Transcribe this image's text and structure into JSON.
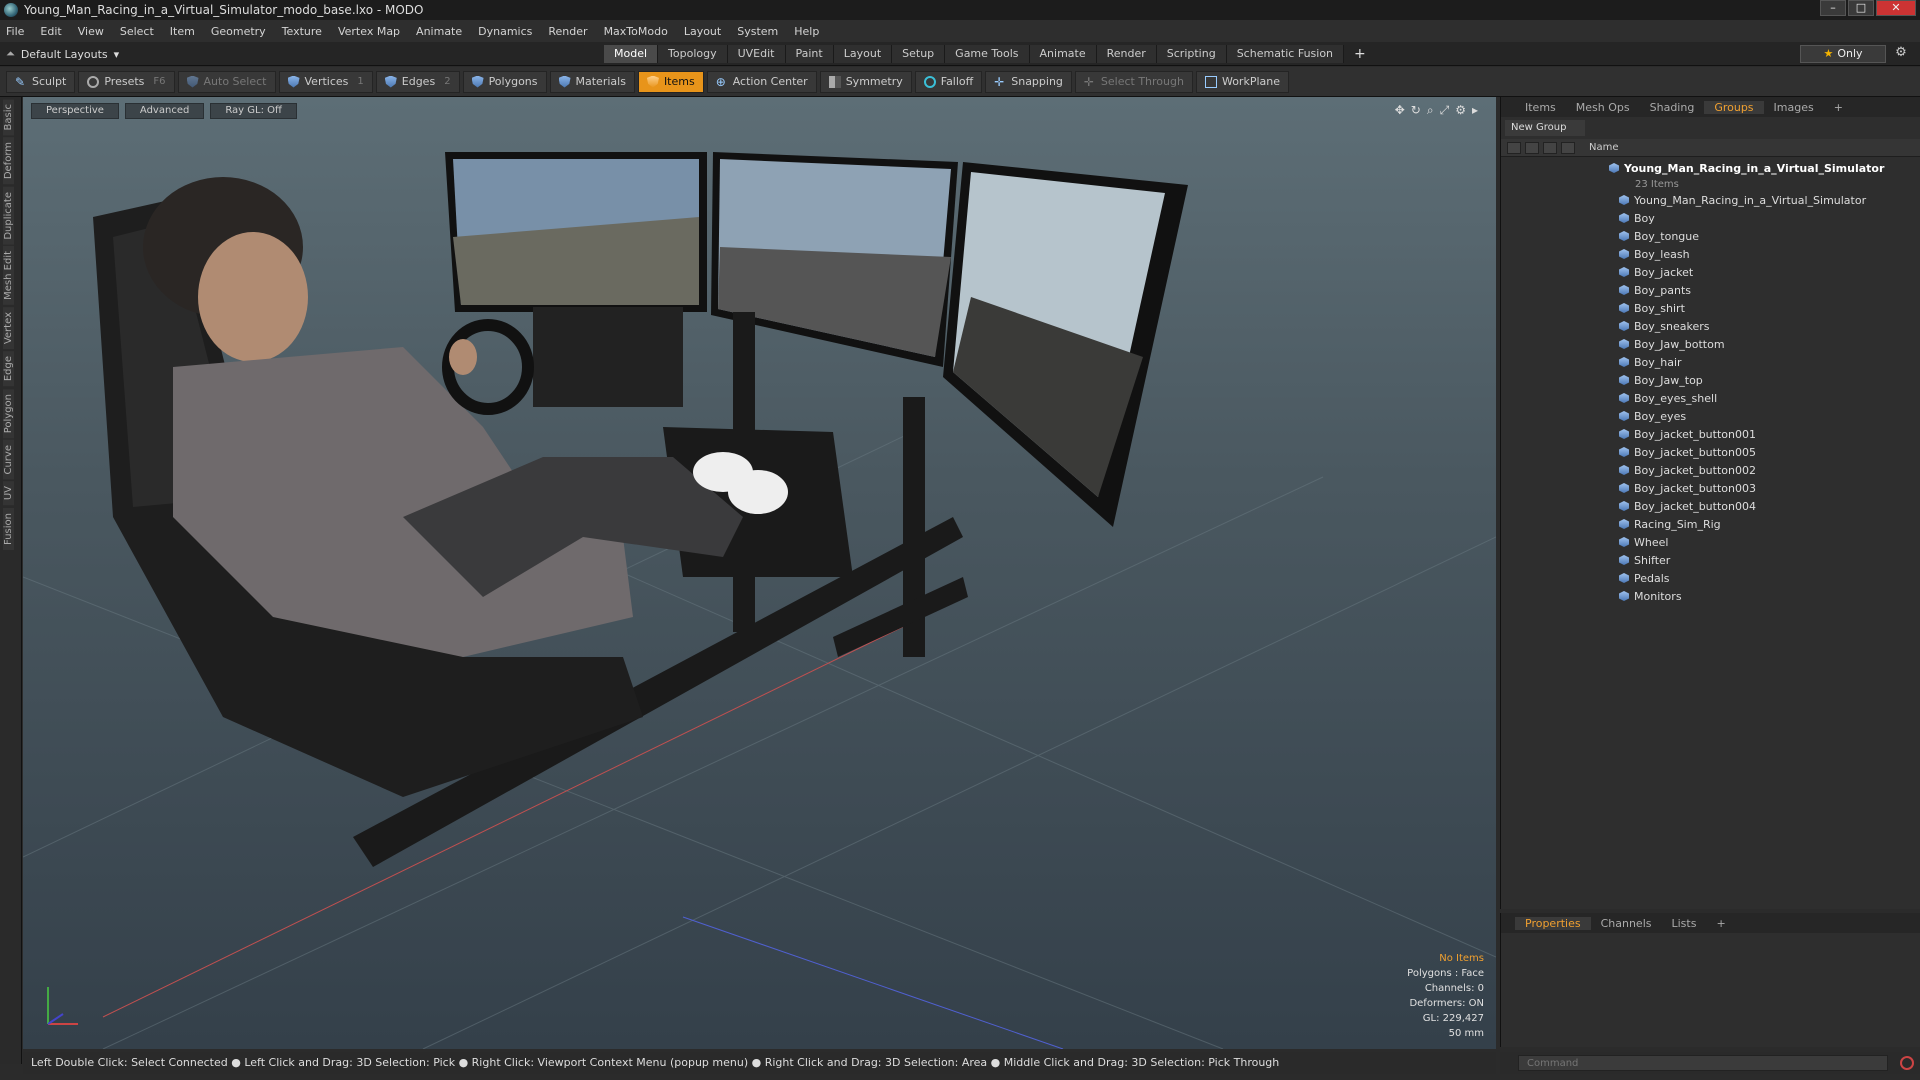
{
  "window": {
    "title": "Young_Man_Racing_in_a_Virtual_Simulator_modo_base.lxo - MODO"
  },
  "menu": [
    "File",
    "Edit",
    "View",
    "Select",
    "Item",
    "Geometry",
    "Texture",
    "Vertex Map",
    "Animate",
    "Dynamics",
    "Render",
    "MaxToModo",
    "Layout",
    "System",
    "Help"
  ],
  "layout": {
    "label": "Default Layouts"
  },
  "mode_tabs": [
    {
      "label": "Model",
      "active": true
    },
    {
      "label": "Topology"
    },
    {
      "label": "UVEdit"
    },
    {
      "label": "Paint"
    },
    {
      "label": "Layout"
    },
    {
      "label": "Setup"
    },
    {
      "label": "Game Tools"
    },
    {
      "label": "Animate"
    },
    {
      "label": "Render"
    },
    {
      "label": "Scripting"
    },
    {
      "label": "Schematic Fusion"
    }
  ],
  "only_label": "Only",
  "toolbar": {
    "sculpt": "Sculpt",
    "presets": "Presets",
    "presets_key": "F6",
    "auto_select": "Auto Select",
    "vertices": "Vertices",
    "vertices_n": "1",
    "edges": "Edges",
    "edges_n": "2",
    "polygons": "Polygons",
    "materials": "Materials",
    "items": "Items",
    "action_center": "Action Center",
    "symmetry": "Symmetry",
    "falloff": "Falloff",
    "snapping": "Snapping",
    "select_through": "Select Through",
    "workplane": "WorkPlane"
  },
  "left_strip": [
    "Basic",
    "Deform",
    "Duplicate",
    "Mesh Edit",
    "Vertex",
    "Edge",
    "Polygon",
    "Curve",
    "UV",
    "Fusion"
  ],
  "viewport": {
    "view": "Perspective",
    "shading": "Advanced",
    "raygl": "Ray GL: Off",
    "info": {
      "items": "No Items",
      "polygons": "Polygons : Face",
      "channels": "Channels: 0",
      "deformers": "Deformers: ON",
      "gl": "GL: 229,427",
      "focal": "50 mm"
    }
  },
  "status": "Left Double Click: Select Connected ● Left Click and Drag: 3D Selection: Pick ● Right Click: Viewport Context Menu (popup menu) ● Right Click and Drag: 3D Selection: Area ● Middle Click and Drag: 3D Selection: Pick Through",
  "panel": {
    "tabs": [
      {
        "label": "Items"
      },
      {
        "label": "Mesh Ops"
      },
      {
        "label": "Shading"
      },
      {
        "label": "Groups",
        "active": true
      },
      {
        "label": "Images"
      }
    ],
    "new_group": "New Group",
    "name_col": "Name",
    "group_name": "Young_Man_Racing_in_a_Virtual_Simulator",
    "group_count": "23 Items",
    "items": [
      "Young_Man_Racing_in_a_Virtual_Simulator",
      "Boy",
      "Boy_tongue",
      "Boy_leash",
      "Boy_jacket",
      "Boy_pants",
      "Boy_shirt",
      "Boy_sneakers",
      "Boy_Jaw_bottom",
      "Boy_hair",
      "Boy_Jaw_top",
      "Boy_eyes_shell",
      "Boy_eyes",
      "Boy_jacket_button001",
      "Boy_jacket_button005",
      "Boy_jacket_button002",
      "Boy_jacket_button003",
      "Boy_jacket_button004",
      "Racing_Sim_Rig",
      "Wheel",
      "Shifter",
      "Pedals",
      "Monitors"
    ]
  },
  "bottom_panel": {
    "tabs": [
      {
        "label": "Properties",
        "active": true
      },
      {
        "label": "Channels"
      },
      {
        "label": "Lists"
      }
    ]
  },
  "command": {
    "placeholder": "Command"
  }
}
